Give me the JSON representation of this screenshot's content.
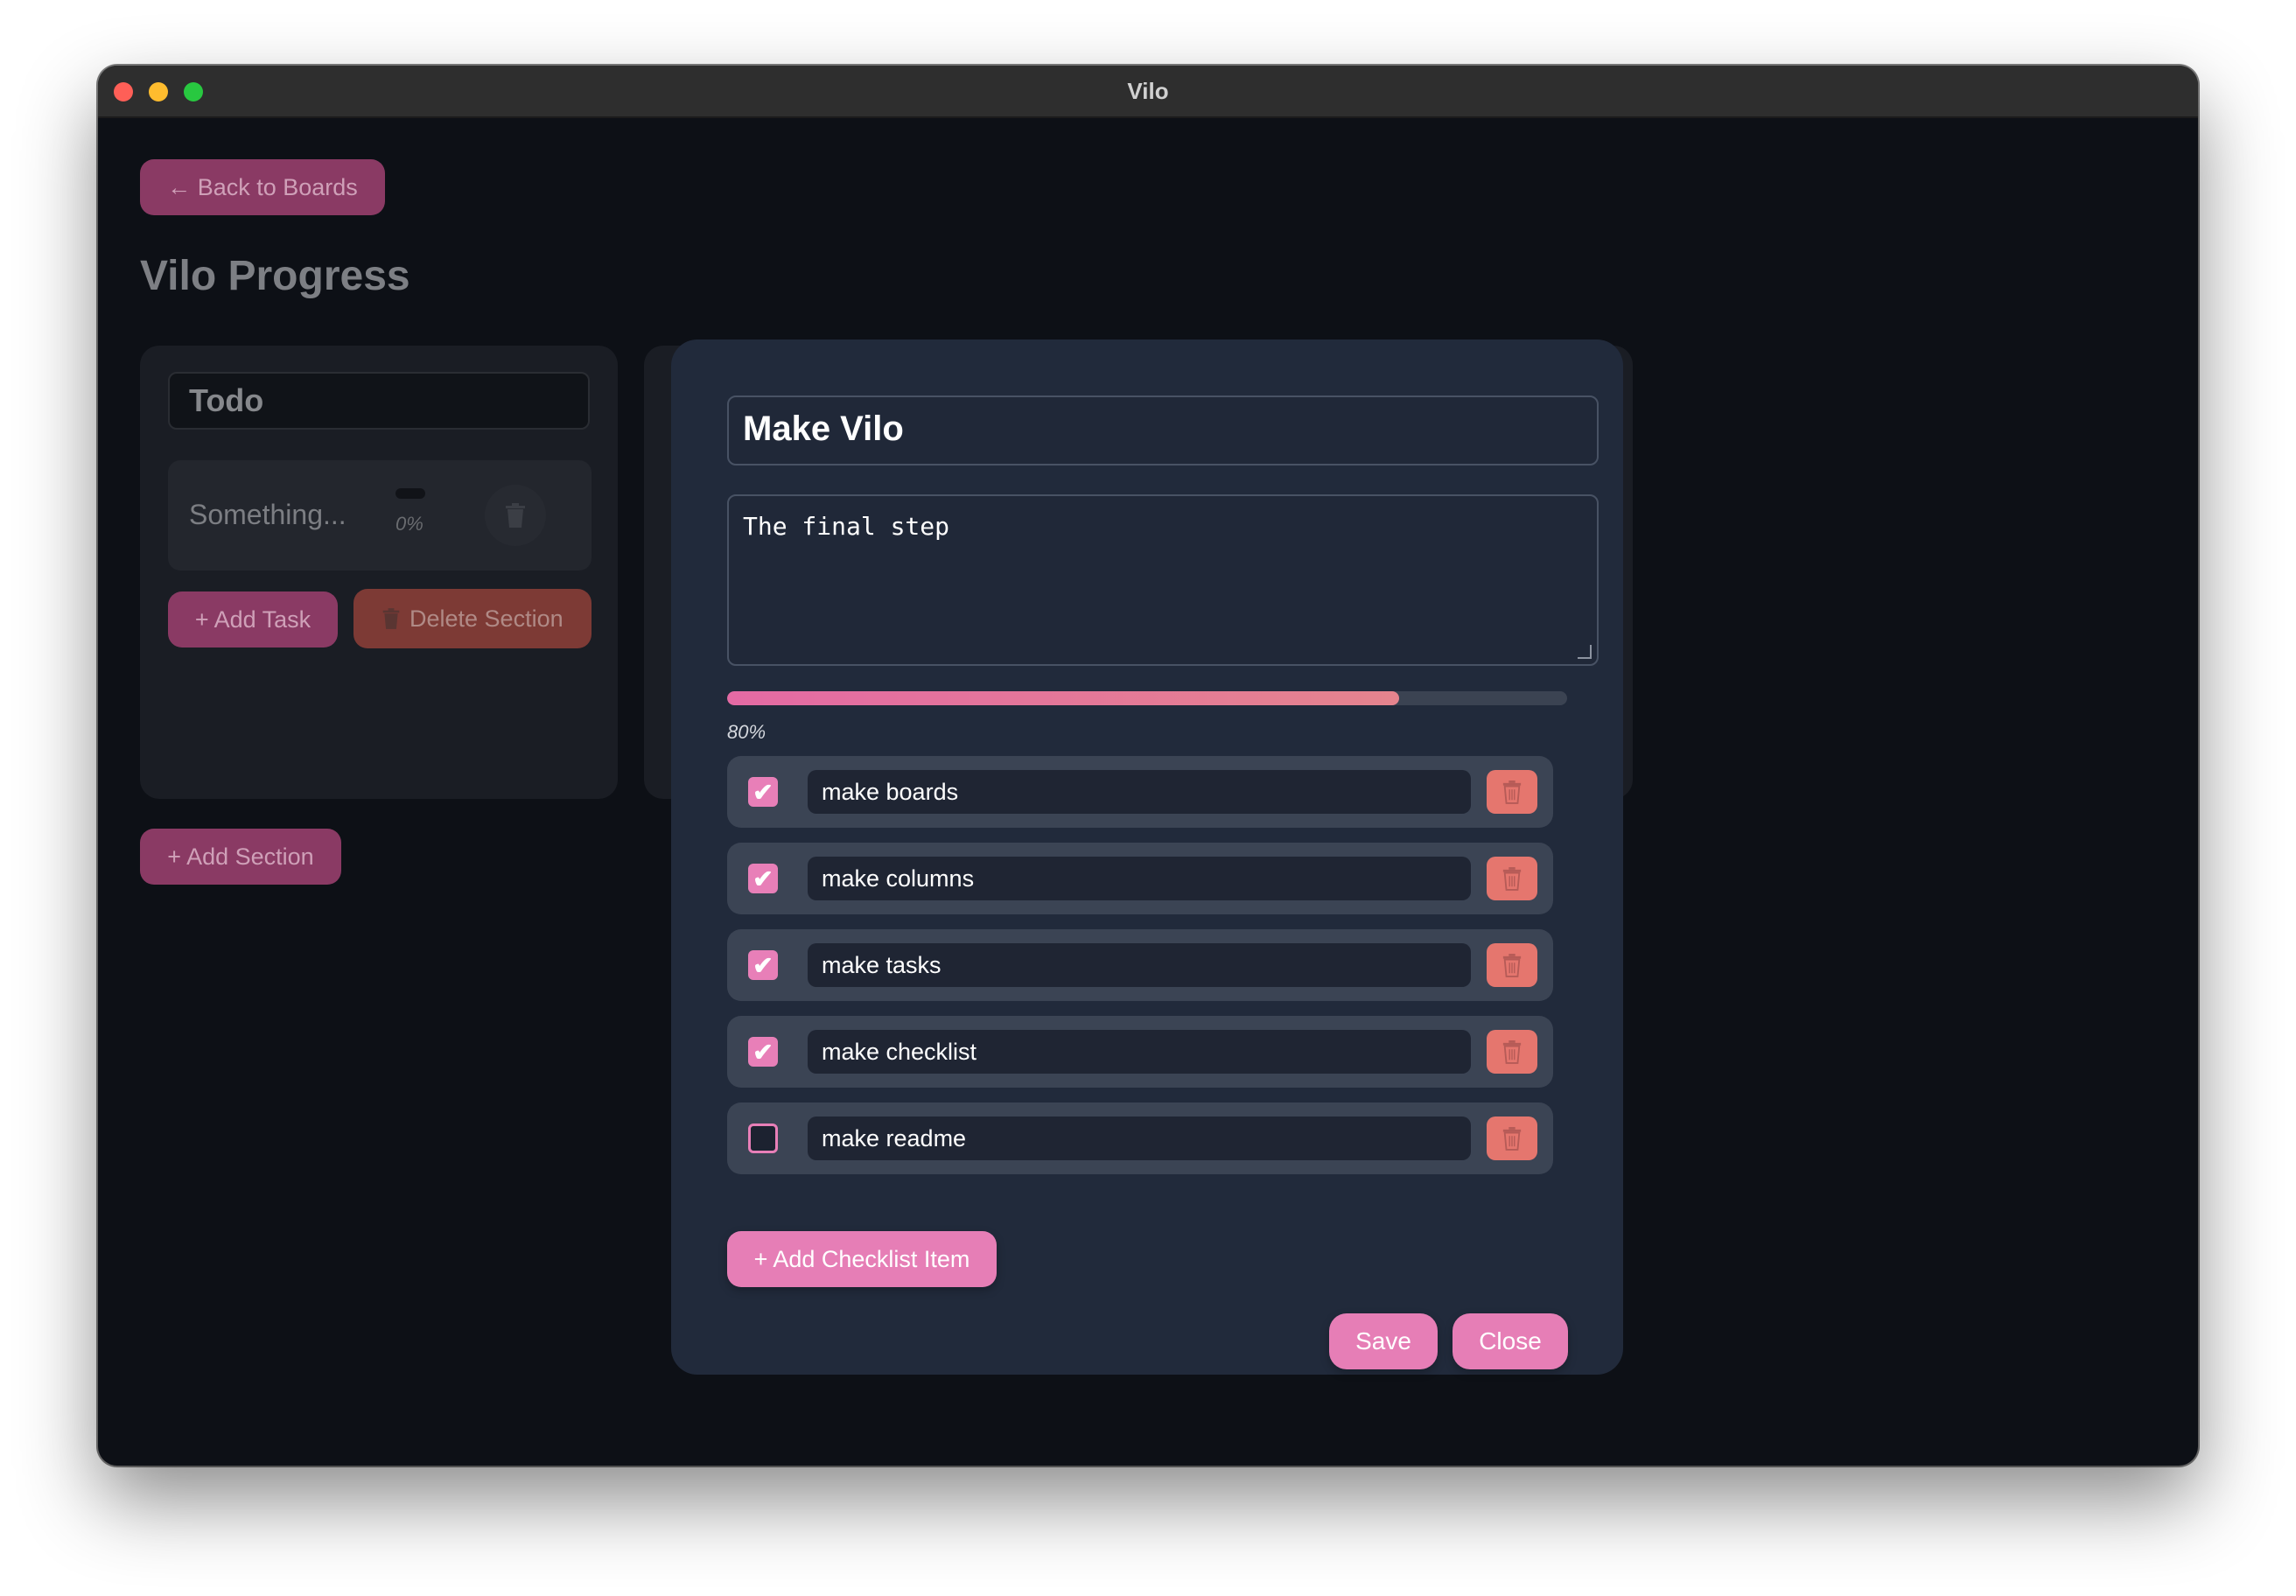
{
  "window": {
    "title": "Vilo"
  },
  "board": {
    "back_label": "← Back to Boards",
    "title": "Vilo Progress",
    "add_section_label": "+ Add Section",
    "sections": [
      {
        "name": "Todo",
        "tasks": [
          {
            "title": "Something...",
            "progress_label": "0%",
            "progress": 0
          }
        ],
        "add_task_label": "+ Add Task",
        "delete_section_label": "Delete Section"
      }
    ]
  },
  "modal": {
    "title": "Make Vilo",
    "description": "The final step",
    "progress": 0.8,
    "progress_label": "80%",
    "checklist": [
      {
        "text": "make boards",
        "checked": true
      },
      {
        "text": "make columns",
        "checked": true
      },
      {
        "text": "make tasks",
        "checked": true
      },
      {
        "text": "make checklist",
        "checked": true
      },
      {
        "text": "make readme",
        "checked": false
      }
    ],
    "add_item_label": "+ Add Checklist Item",
    "save_label": "Save",
    "close_label": "Close"
  },
  "icons": {
    "trash": "trash-icon",
    "check": "checkmark-icon"
  },
  "colors": {
    "accent": "#e67eb6",
    "danger": "#e5766e",
    "modal_bg": "#212a3b",
    "app_bg": "#0d1016"
  }
}
